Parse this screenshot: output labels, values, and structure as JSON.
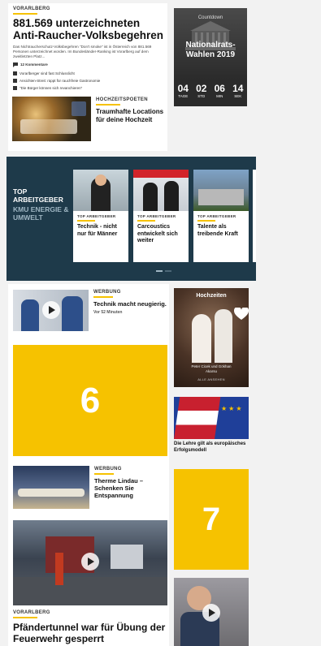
{
  "top_article": {
    "kicker": "VORARLBERG",
    "headline": "881.569 unterzeichneten Anti-Raucher-Volksbegehren",
    "teaser": "Das Nichtraucherschutz-Volksbegehren \"Don't smoke\" ist in Österreich von 881.569 Personen unterzeichnet worden. Im Bundesländer-Ranking ist Vorarlberg auf dem zweitletzten Platz...",
    "comments": "12 Kommentare",
    "related": [
      "Vorarlberger sind fast Schlusslicht",
      "Ansichten-Streit: rüppt für rauchfreie Gastronomie",
      "\"Die Bürger können sich revanchieren\""
    ]
  },
  "countdown": {
    "label": "Countdown",
    "title": "Nationalrats-Wahlen 2019",
    "units": [
      {
        "value": "04",
        "label": "TAGE"
      },
      {
        "value": "02",
        "label": "STD"
      },
      {
        "value": "06",
        "label": "MIN"
      },
      {
        "value": "14",
        "label": "SEK"
      }
    ]
  },
  "hochzeit_teaser": {
    "kicker": "HOCHZEITSPOETEN",
    "headline": "Traumhafte Locations für deine Hochzeit"
  },
  "arbeitgeber": {
    "title": "TOP ARBEITGEBER",
    "subtitle": "KMU ENERGIE & UMWELT",
    "cards": [
      {
        "kicker": "TOP ARBEITGEBER",
        "headline": "Technik - nicht nur für Männer"
      },
      {
        "kicker": "TOP ARBEITGEBER",
        "headline": "Carcoustics entwickelt sich weiter"
      },
      {
        "kicker": "TOP ARBEITGEBER",
        "headline": "Talente als treibende Kraft"
      }
    ]
  },
  "werbung1": {
    "kicker": "WERBUNG",
    "headline": "Technik macht neugierig.",
    "time": "Vor 52 Minuten"
  },
  "hochzeiten": {
    "title": "Hochzeiten",
    "names": "Peter Cicek und Gökhan Akarsu",
    "link": "ALLE ANSEHEN"
  },
  "ad_slot_6": "6",
  "eu_teaser": {
    "headline": "Die Lehre gilt als europäisches Erfolgsmodell"
  },
  "werbung2": {
    "kicker": "WERBUNG",
    "headline": "Therme Lindau – Schenken Sie Entspannung"
  },
  "ad_slot_7": "7",
  "bottom_article": {
    "kicker": "VORARLBERG",
    "headline": "Pfändertunnel war für Übung der Feuerwehr gesperrt"
  },
  "colors": {
    "accent_yellow": "#f6c200",
    "navy": "#1e3a4a",
    "countdown_bg": "#2b2b2b",
    "heart": "#ffffff"
  }
}
